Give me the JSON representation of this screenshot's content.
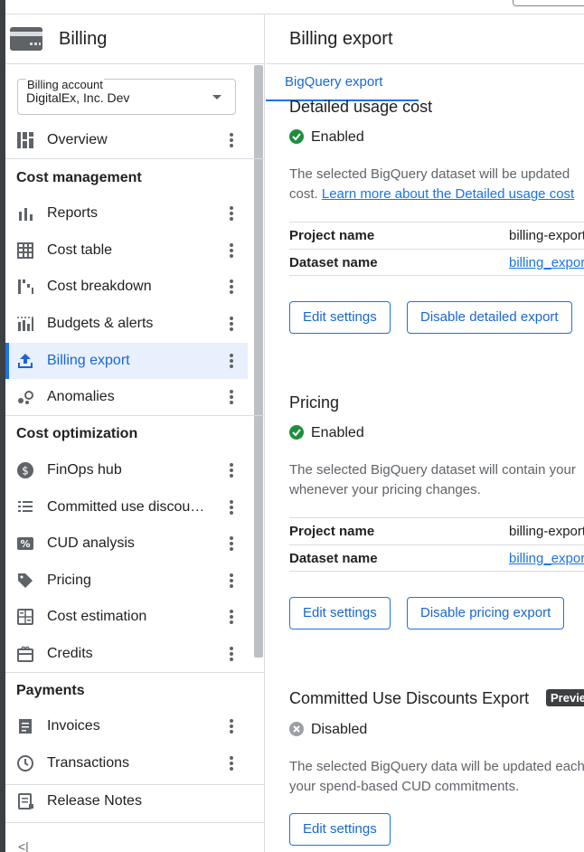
{
  "sidebar": {
    "title": "Billing",
    "account": {
      "label": "Billing account",
      "value": "DigitalEx, Inc. Dev"
    },
    "overview": "Overview",
    "sections": {
      "cost_management": "Cost management",
      "cost_optimization": "Cost optimization",
      "payments": "Payments"
    },
    "items": {
      "reports": "Reports",
      "cost_table": "Cost table",
      "cost_breakdown": "Cost breakdown",
      "budgets": "Budgets & alerts",
      "billing_export": "Billing export",
      "anomalies": "Anomalies",
      "finops": "FinOps hub",
      "cud": "Committed use discou…",
      "cud_analysis": "CUD analysis",
      "pricing": "Pricing",
      "cost_estimation": "Cost estimation",
      "credits": "Credits",
      "invoices": "Invoices",
      "transactions": "Transactions"
    },
    "release_notes": "Release Notes",
    "collapse": "<|"
  },
  "main": {
    "title": "Billing export",
    "tab": "BigQuery export",
    "detailed": {
      "heading": "Detailed usage cost",
      "status": "Enabled",
      "desc_line1": "The selected BigQuery dataset will be updated",
      "desc_line2": "cost.",
      "desc_link": "Learn more about the Detailed usage cost",
      "project_label": "Project name",
      "project_value": "billing-export",
      "dataset_label": "Dataset name",
      "dataset_value": "billing_export",
      "edit": "Edit settings",
      "disable": "Disable detailed export"
    },
    "pricing": {
      "heading": "Pricing",
      "status": "Enabled",
      "desc_line1": "The selected BigQuery dataset will contain your",
      "desc_line2": "whenever your pricing changes.",
      "project_label": "Project name",
      "project_value": "billing-export",
      "dataset_label": "Dataset name",
      "dataset_value": "billing_export",
      "edit": "Edit settings",
      "disable": "Disable pricing export"
    },
    "cud": {
      "heading": "Committed Use Discounts Export",
      "badge": "Preview",
      "status": "Disabled",
      "desc_line1": "The selected BigQuery data will be updated each",
      "desc_line2": "your spend-based CUD commitments.",
      "edit": "Edit settings"
    }
  },
  "colors": {
    "accent": "#1a73e8",
    "active_bg": "#e8f0fe",
    "enabled": "#1e8e3e",
    "disabled": "#9aa0a6"
  }
}
